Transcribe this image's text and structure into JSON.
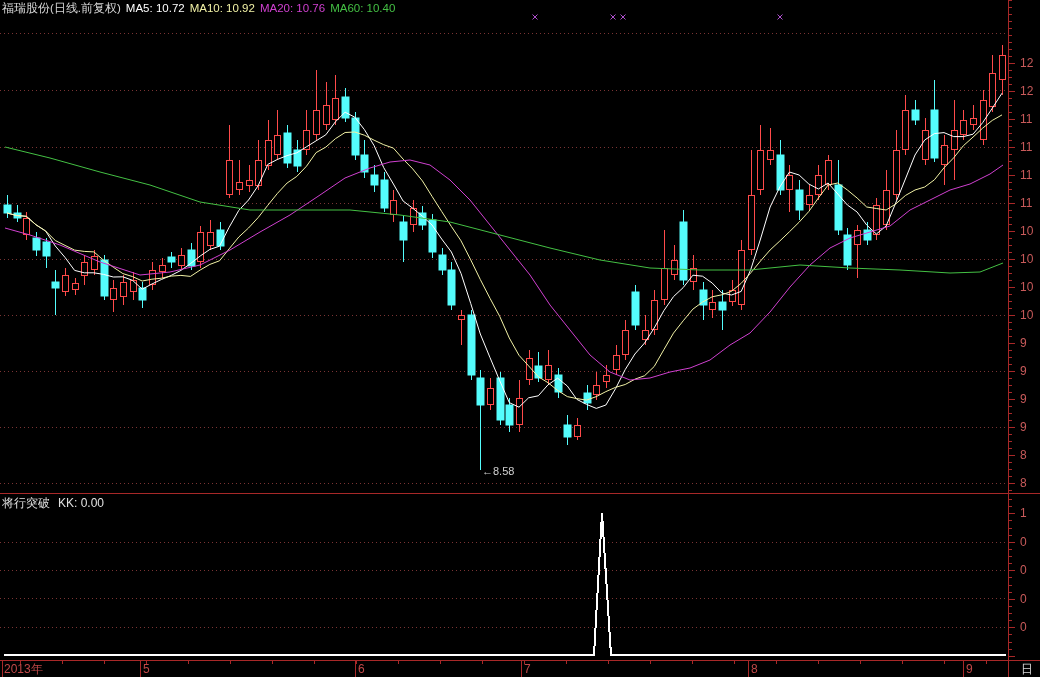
{
  "chart": {
    "title": "福瑞股份(日线.前复权)",
    "moving_averages": [
      {
        "label": "MA5: 10.72",
        "color": "#ffffff"
      },
      {
        "label": "MA10: 10.92",
        "color": "#f2f2a6"
      },
      {
        "label": "MA20: 10.76",
        "color": "#d040d0"
      },
      {
        "label": "MA60: 10.40",
        "color": "#44c044"
      }
    ],
    "low_marker": "←8.58",
    "price_axis": [
      "12",
      "12",
      "11",
      "11",
      "11",
      "11",
      "10",
      "10",
      "10",
      "10",
      "9",
      "9",
      "9",
      "9",
      "8",
      "8"
    ]
  },
  "indicator": {
    "title": "将行突破",
    "reading": "KK: 0.00",
    "axis": [
      "1",
      "0",
      "0",
      "0",
      "0"
    ]
  },
  "time_axis": {
    "labels": [
      "2013年",
      "5",
      "6",
      "7",
      "8",
      "9"
    ],
    "period": "日"
  }
}
